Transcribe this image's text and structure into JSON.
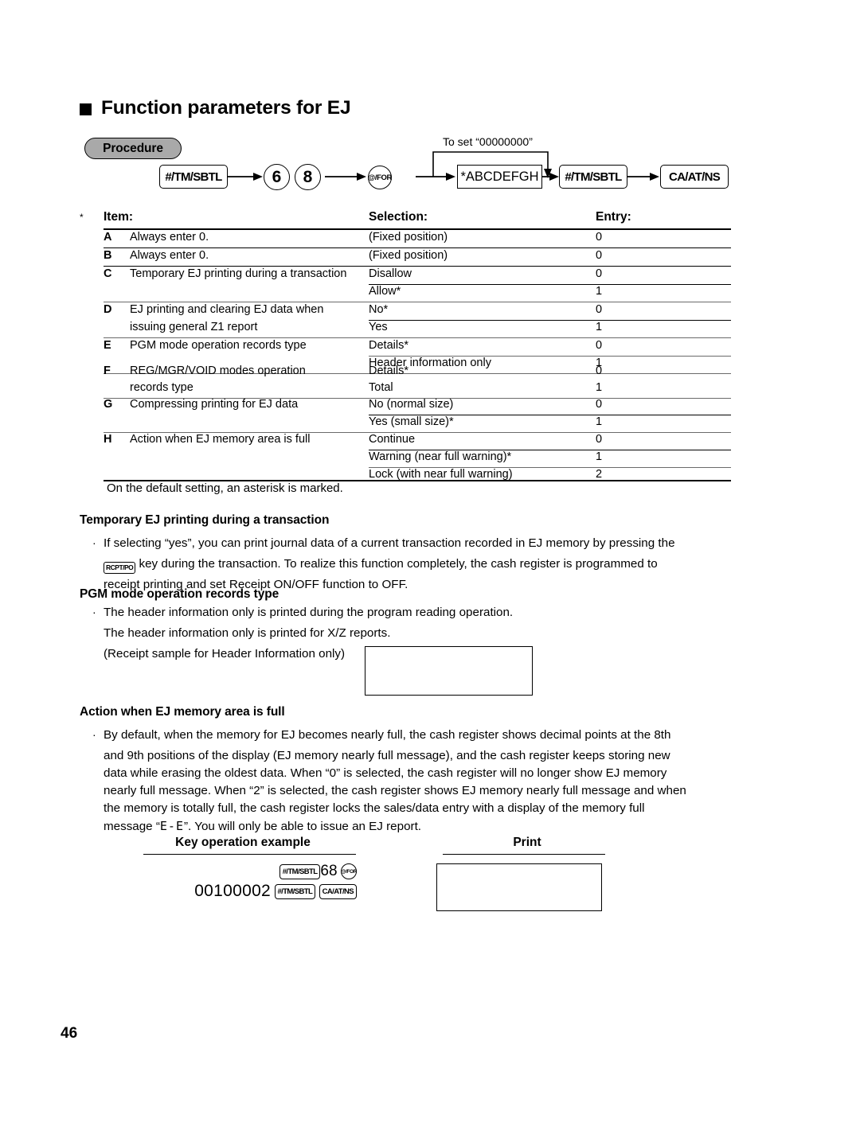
{
  "page": {
    "number": "46",
    "section_title": "Function parameters for EJ",
    "procedure_badge": "Procedure"
  },
  "procedure_flow": {
    "top_note": "To set “00000000”",
    "steps": [
      {
        "id": "step-tmsbtl-1",
        "label": "#/TM/SBTL",
        "shape": "rounded-rect"
      },
      {
        "id": "step-digit-6",
        "label": "6",
        "shape": "circle"
      },
      {
        "id": "step-digit-8",
        "label": "8",
        "shape": "circle"
      },
      {
        "id": "step-atfor",
        "label": "@/FOR",
        "shape": "circle"
      },
      {
        "id": "step-abcdefgh",
        "label": "*ABCDEFGH",
        "shape": "rect"
      },
      {
        "id": "step-tmsbtl-2",
        "label": "#/TM/SBTL",
        "shape": "rounded-rect"
      },
      {
        "id": "step-caatns",
        "label": "CA/AT/NS",
        "shape": "rounded-rect"
      }
    ]
  },
  "param_table": {
    "star_marker": "*",
    "headers": {
      "item": "Item:",
      "selection": "Selection:",
      "entry": "Entry:"
    },
    "rows": [
      {
        "letter": "A",
        "desc": "Always enter 0.",
        "desc2": "",
        "options": [
          {
            "selection": "(Fixed position)",
            "entry": "0"
          }
        ]
      },
      {
        "letter": "B",
        "desc": "Always enter 0.",
        "desc2": "",
        "options": [
          {
            "selection": "(Fixed position)",
            "entry": "0"
          }
        ]
      },
      {
        "letter": "C",
        "desc": "Temporary EJ printing during a transaction",
        "desc2": "",
        "options": [
          {
            "selection": "Disallow",
            "entry": "0"
          },
          {
            "selection": "Allow*",
            "entry": "1"
          }
        ]
      },
      {
        "letter": "D",
        "desc": "EJ printing and clearing EJ data when",
        "desc2": "issuing general Z1 report",
        "options": [
          {
            "selection": "No*",
            "entry": "0"
          },
          {
            "selection": "Yes",
            "entry": "1"
          }
        ]
      },
      {
        "letter": "E",
        "desc": "PGM mode operation records type",
        "desc2": "",
        "options": [
          {
            "selection": "Details*",
            "entry": "0"
          },
          {
            "selection": "Header information only",
            "entry": "1"
          }
        ]
      },
      {
        "letter": "F",
        "desc": "REG/MGR/VOID modes operation",
        "desc2": "records type",
        "options": [
          {
            "selection": "Details*",
            "entry": "0"
          },
          {
            "selection": "Total",
            "entry": "1"
          }
        ]
      },
      {
        "letter": "G",
        "desc": "Compressing printing for EJ data",
        "desc2": "",
        "options": [
          {
            "selection": "No (normal size)",
            "entry": "0"
          },
          {
            "selection": "Yes (small size)*",
            "entry": "1"
          }
        ]
      },
      {
        "letter": "H",
        "desc": "Action when EJ memory area is full",
        "desc2": "",
        "options": [
          {
            "selection": "Continue",
            "entry": "0"
          },
          {
            "selection": "Warning (near full warning)*",
            "entry": "1"
          },
          {
            "selection": "Lock (with near full warning)",
            "entry": "2"
          }
        ]
      }
    ],
    "footnote": "On the default setting, an asterisk is marked."
  },
  "sections": [
    {
      "id": "temporary-ej",
      "heading": "Temporary EJ printing during a transaction",
      "line1_pre": "If selecting “yes”, you can print journal data of a current transaction recorded in EJ memory by pressing the",
      "line2_key": "RCPT/PO",
      "line2_post": "key during the transaction.  To realize this function completely, the cash register is programmed to",
      "line3": "receipt printing and set Receipt ON/OFF function to OFF."
    },
    {
      "id": "pgm-mode",
      "heading": "PGM mode operation records type",
      "line1": "The header information only is printed during the program reading operation.",
      "line2": "The header information only is printed for X/Z reports.",
      "line3": "(Receipt sample for Header Information only)"
    },
    {
      "id": "memory-full",
      "heading": "Action when EJ memory area is full",
      "line1": "By default, when the memory for EJ becomes nearly full, the cash register shows decimal points at the 8th",
      "line2": "and 9th positions of the display (EJ memory nearly full message), and the cash register keeps storing new",
      "line3": "data while erasing the oldest data.  When “0” is selected, the cash register will no longer show EJ memory",
      "line4": "nearly full message.  When “2” is selected, the cash register shows EJ memory nearly full message and when",
      "line5": "the memory is totally full, the cash register locks the sales/data entry with a display of the memory full",
      "line6_pre": "message “",
      "line6_glyph": "E-E",
      "line6_post": "”.  You will only be able to issue an EJ report."
    }
  ],
  "key_operation": {
    "heading_keyop": "Key operation example",
    "heading_print": "Print",
    "line1": {
      "key1": "#/TM/SBTL",
      "num": "68",
      "key2": "@/FOR"
    },
    "line2": {
      "value": "00100002",
      "key1": "#/TM/SBTL",
      "key2": "CA/AT/NS"
    }
  }
}
